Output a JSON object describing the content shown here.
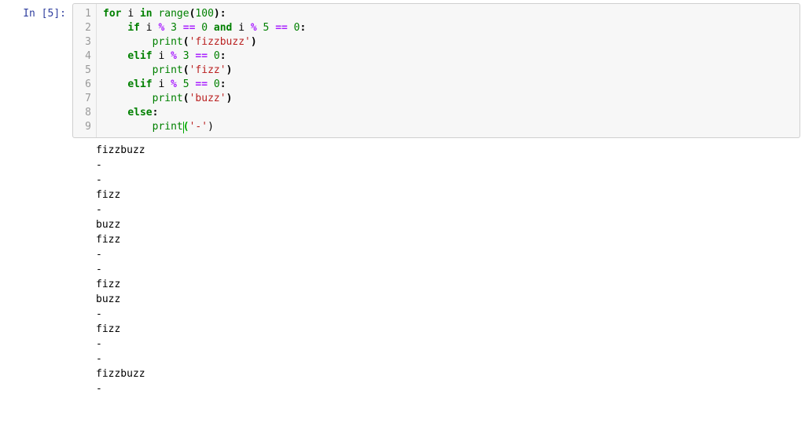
{
  "prompt": {
    "label": "In [5]:",
    "number": 5
  },
  "code": {
    "lines": [
      [
        {
          "t": "for",
          "c": "kw"
        },
        {
          "t": " "
        },
        {
          "t": "i",
          "c": "var"
        },
        {
          "t": " "
        },
        {
          "t": "in",
          "c": "kw"
        },
        {
          "t": " "
        },
        {
          "t": "range",
          "c": "bip"
        },
        {
          "t": "(",
          "c": "pun"
        },
        {
          "t": "100",
          "c": "num"
        },
        {
          "t": "):",
          "c": "pun"
        }
      ],
      [
        {
          "t": "    "
        },
        {
          "t": "if",
          "c": "kw"
        },
        {
          "t": " "
        },
        {
          "t": "i",
          "c": "var"
        },
        {
          "t": " "
        },
        {
          "t": "%",
          "c": "op"
        },
        {
          "t": " "
        },
        {
          "t": "3",
          "c": "num"
        },
        {
          "t": " "
        },
        {
          "t": "==",
          "c": "op"
        },
        {
          "t": " "
        },
        {
          "t": "0",
          "c": "num"
        },
        {
          "t": " "
        },
        {
          "t": "and",
          "c": "kw"
        },
        {
          "t": " "
        },
        {
          "t": "i",
          "c": "var"
        },
        {
          "t": " "
        },
        {
          "t": "%",
          "c": "op"
        },
        {
          "t": " "
        },
        {
          "t": "5",
          "c": "num"
        },
        {
          "t": " "
        },
        {
          "t": "==",
          "c": "op"
        },
        {
          "t": " "
        },
        {
          "t": "0",
          "c": "num"
        },
        {
          "t": ":",
          "c": "pun"
        }
      ],
      [
        {
          "t": "        "
        },
        {
          "t": "print",
          "c": "bip"
        },
        {
          "t": "(",
          "c": "pun"
        },
        {
          "t": "'fizzbuzz'",
          "c": "str"
        },
        {
          "t": ")",
          "c": "pun"
        }
      ],
      [
        {
          "t": "    "
        },
        {
          "t": "elif",
          "c": "kw"
        },
        {
          "t": " "
        },
        {
          "t": "i",
          "c": "var"
        },
        {
          "t": " "
        },
        {
          "t": "%",
          "c": "op"
        },
        {
          "t": " "
        },
        {
          "t": "3",
          "c": "num"
        },
        {
          "t": " "
        },
        {
          "t": "==",
          "c": "op"
        },
        {
          "t": " "
        },
        {
          "t": "0",
          "c": "num"
        },
        {
          "t": ":",
          "c": "pun"
        }
      ],
      [
        {
          "t": "        "
        },
        {
          "t": "print",
          "c": "bip"
        },
        {
          "t": "(",
          "c": "pun"
        },
        {
          "t": "'fizz'",
          "c": "str"
        },
        {
          "t": ")",
          "c": "pun"
        }
      ],
      [
        {
          "t": "    "
        },
        {
          "t": "elif",
          "c": "kw"
        },
        {
          "t": " "
        },
        {
          "t": "i",
          "c": "var"
        },
        {
          "t": " "
        },
        {
          "t": "%",
          "c": "op"
        },
        {
          "t": " "
        },
        {
          "t": "5",
          "c": "num"
        },
        {
          "t": " "
        },
        {
          "t": "==",
          "c": "op"
        },
        {
          "t": " "
        },
        {
          "t": "0",
          "c": "num"
        },
        {
          "t": ":",
          "c": "pun"
        }
      ],
      [
        {
          "t": "        "
        },
        {
          "t": "print",
          "c": "bip"
        },
        {
          "t": "(",
          "c": "pun"
        },
        {
          "t": "'buzz'",
          "c": "str"
        },
        {
          "t": ")",
          "c": "pun"
        }
      ],
      [
        {
          "t": "    "
        },
        {
          "t": "else",
          "c": "kw"
        },
        {
          "t": ":",
          "c": "pun"
        }
      ],
      [
        {
          "t": "        "
        },
        {
          "t": "print",
          "c": "bip"
        },
        {
          "t": "(",
          "c": "wrap cursor-span"
        },
        {
          "t": "'-'",
          "c": "str"
        },
        {
          "t": ")",
          "c": "wrap"
        }
      ]
    ],
    "line_numbers": [
      "1",
      "2",
      "3",
      "4",
      "5",
      "6",
      "7",
      "8",
      "9"
    ]
  },
  "output_lines": [
    "fizzbuzz",
    "-",
    "-",
    "fizz",
    "-",
    "buzz",
    "fizz",
    "-",
    "-",
    "fizz",
    "buzz",
    "-",
    "fizz",
    "-",
    "-",
    "fizzbuzz",
    "-"
  ]
}
